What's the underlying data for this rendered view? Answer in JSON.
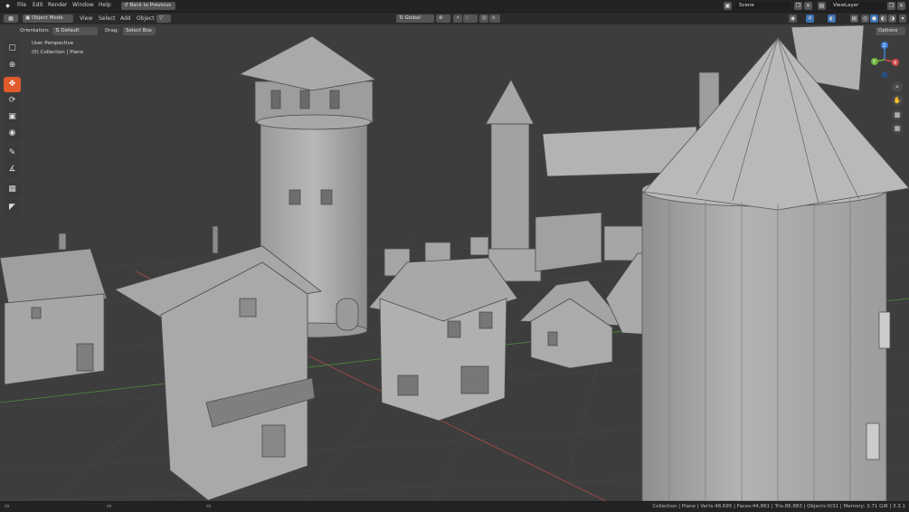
{
  "topbar": {
    "menus": [
      "File",
      "Edit",
      "Render",
      "Window",
      "Help"
    ],
    "back_button": "Back to Previous",
    "scene_label": "Scene",
    "viewlayer_label": "ViewLayer"
  },
  "header": {
    "mode": "Object Mode",
    "menus": [
      "View",
      "Select",
      "Add",
      "Object"
    ],
    "transform_orientation": "Global"
  },
  "tool_header": {
    "orientation_label": "Orientation:",
    "orientation_value": "Default",
    "drag_label": "Drag:",
    "drag_value": "Select Box",
    "options_label": "Options"
  },
  "viewport": {
    "perspective": "User Perspective",
    "collection": "(0) Collection | Plane"
  },
  "gizmo": {
    "x": "X",
    "y": "Y",
    "z": "Z"
  },
  "colors": {
    "accent": "#e05a2b",
    "axis_x": "#d14a4a",
    "axis_y": "#6fb43f",
    "axis_z": "#3b7fd8"
  },
  "statusbar": {
    "text": "Collection | Plane | Verts:48,695 | Faces:44,861 | Tris:86,883 | Objects:0/31 | Memory: 3.71 GiB | 3.3.1"
  }
}
